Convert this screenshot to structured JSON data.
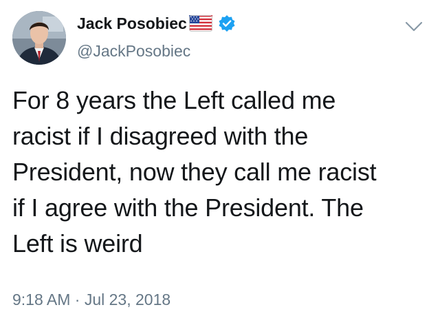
{
  "author": {
    "name": "Jack Posobiec",
    "handle": "@JackPosobiec",
    "emoji_icon": "us-flag-icon",
    "verified_icon": "verified-badge-icon"
  },
  "tweet": {
    "text": "For 8 years the Left called me\nracist if I disagreed with the\nPresident, now they call me racist\nif I agree with the President. The\nLeft is weird",
    "timestamp": "9:18 AM · Jul 23, 2018"
  },
  "menu": {
    "icon": "chevron-down-icon"
  },
  "colors": {
    "text_primary": "#14171a",
    "text_secondary": "#657786",
    "verified_blue": "#1da1f2"
  }
}
